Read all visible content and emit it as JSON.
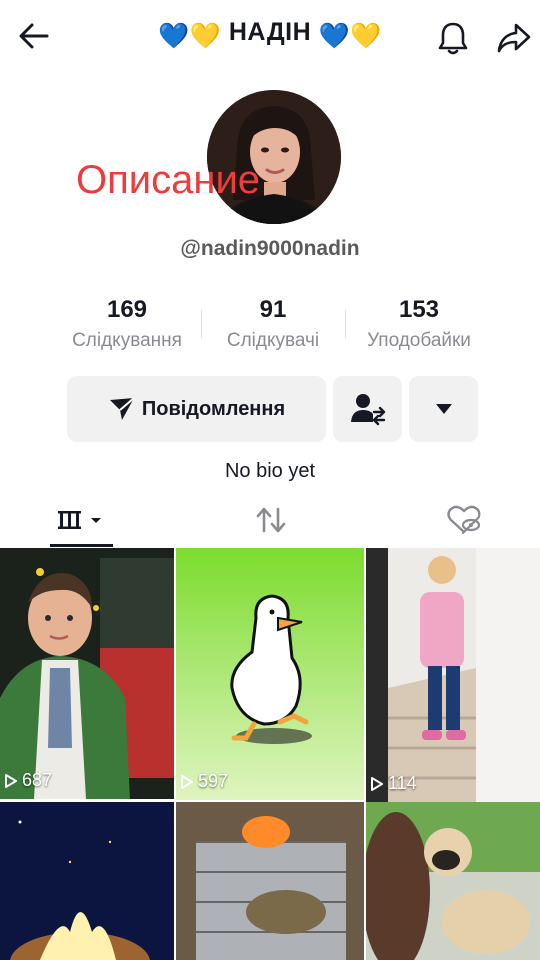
{
  "header": {
    "title_prefix": "💙💛",
    "title_name": "НАДІН",
    "title_suffix": "💙💛"
  },
  "profile": {
    "overlay_label": "Описание",
    "username": "@nadin9000nadin",
    "bio": "No bio yet"
  },
  "stats": [
    {
      "value": "169",
      "label": "Слідкування"
    },
    {
      "value": "91",
      "label": "Слідкувачі"
    },
    {
      "value": "153",
      "label": "Уподобайки"
    }
  ],
  "actions": {
    "message_label": "Повідомлення"
  },
  "tabs": [
    "videos-grid-icon",
    "reposts-icon",
    "liked-hidden-icon"
  ],
  "videos": [
    {
      "views": "687"
    },
    {
      "views": "597"
    },
    {
      "views": "114"
    },
    {
      "views": ""
    },
    {
      "views": ""
    },
    {
      "views": ""
    }
  ],
  "colors": {
    "text": "#161823",
    "secondary": "#8a8b91",
    "button_bg": "#f1f1f2",
    "overlay_red": "#ee3b3b"
  }
}
